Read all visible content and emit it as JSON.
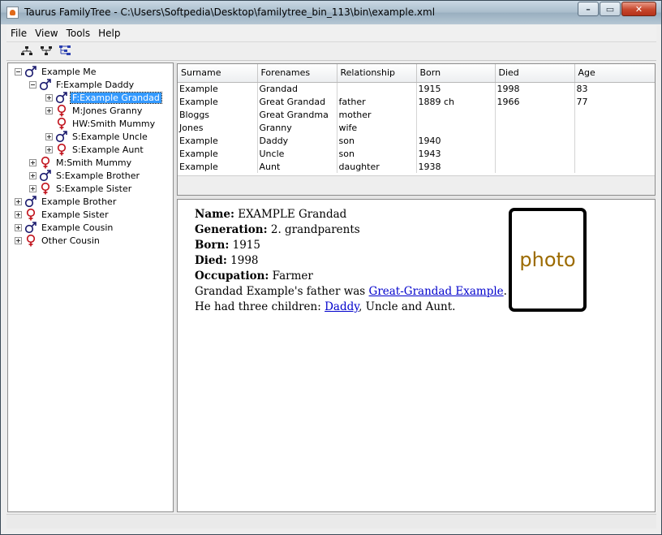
{
  "window": {
    "title": "Taurus FamilyTree - C:\\Users\\Softpedia\\Desktop\\familytree_bin_113\\bin\\example.xml",
    "minimize": "–",
    "maximize": "▭",
    "close": "✕"
  },
  "menu": [
    "File",
    "View",
    "Tools",
    "Help"
  ],
  "toolbar": {
    "buttons": [
      "descendants-tree-icon",
      "ancestors-tree-icon",
      "hourglass-tree-icon"
    ]
  },
  "tree": {
    "rows": [
      {
        "label": "Example Me",
        "sex": "male",
        "expander": "minus",
        "level": 0
      },
      {
        "label": "F:Example Daddy",
        "sex": "male",
        "expander": "minus",
        "level": 1
      },
      {
        "label": "F:Example Grandad",
        "sex": "male",
        "expander": "plus",
        "level": 2,
        "selected": true
      },
      {
        "label": "M:Jones Granny",
        "sex": "female",
        "expander": "plus",
        "level": 2
      },
      {
        "label": "HW:Smith Mummy",
        "sex": "female",
        "expander": "none",
        "level": 2
      },
      {
        "label": "S:Example Uncle",
        "sex": "male",
        "expander": "plus",
        "level": 2
      },
      {
        "label": "S:Example Aunt",
        "sex": "female",
        "expander": "plus",
        "level": 2
      },
      {
        "label": "M:Smith Mummy",
        "sex": "female",
        "expander": "plus",
        "level": 1
      },
      {
        "label": "S:Example Brother",
        "sex": "male",
        "expander": "plus",
        "level": 1
      },
      {
        "label": "S:Example Sister",
        "sex": "female",
        "expander": "plus",
        "level": 1
      },
      {
        "label": "Example Brother",
        "sex": "male",
        "expander": "plus",
        "level": 0
      },
      {
        "label": "Example Sister",
        "sex": "female",
        "expander": "plus",
        "level": 0
      },
      {
        "label": "Example Cousin",
        "sex": "male",
        "expander": "plus",
        "level": 0
      },
      {
        "label": "Other Cousin",
        "sex": "female",
        "expander": "plus",
        "level": 0
      }
    ]
  },
  "table": {
    "columns": [
      "Surname",
      "Forenames",
      "Relationship",
      "Born",
      "Died",
      "Age"
    ],
    "rows": [
      [
        "Example",
        "Grandad",
        "",
        "1915",
        "1998",
        "83"
      ],
      [
        "Example",
        "Great Grandad",
        "father",
        "1889 ch",
        "1966",
        "77"
      ],
      [
        "Bloggs",
        "Great Grandma",
        "mother",
        "",
        "",
        ""
      ],
      [
        "Jones",
        "Granny",
        "wife",
        "",
        "",
        ""
      ],
      [
        "Example",
        "Daddy",
        "son",
        "1940",
        "",
        ""
      ],
      [
        "Example",
        "Uncle",
        "son",
        "1943",
        "",
        ""
      ],
      [
        "Example",
        "Aunt",
        "daughter",
        "1938",
        "",
        ""
      ]
    ]
  },
  "detail": {
    "name_label": "Name:",
    "name_value": "EXAMPLE Grandad",
    "generation_label": "Generation:",
    "generation_value": "2. grandparents",
    "born_label": "Born:",
    "born_value": "1915",
    "died_label": "Died:",
    "died_value": "1998",
    "occupation_label": "Occupation:",
    "occupation_value": "Farmer",
    "father_text": "Grandad Example's father was ",
    "father_link": "Great-Grandad Example",
    "father_end": ".",
    "children_text": "He had three children: ",
    "children_link": "Daddy",
    "children_end": ", Uncle and Aunt.",
    "photo_label": "photo"
  },
  "colors": {
    "male_icon": "#1a1a6e",
    "female_icon": "#c0101a",
    "selection": "#3399ff",
    "link": "#0000cc",
    "photo_text": "#9c6b00"
  }
}
